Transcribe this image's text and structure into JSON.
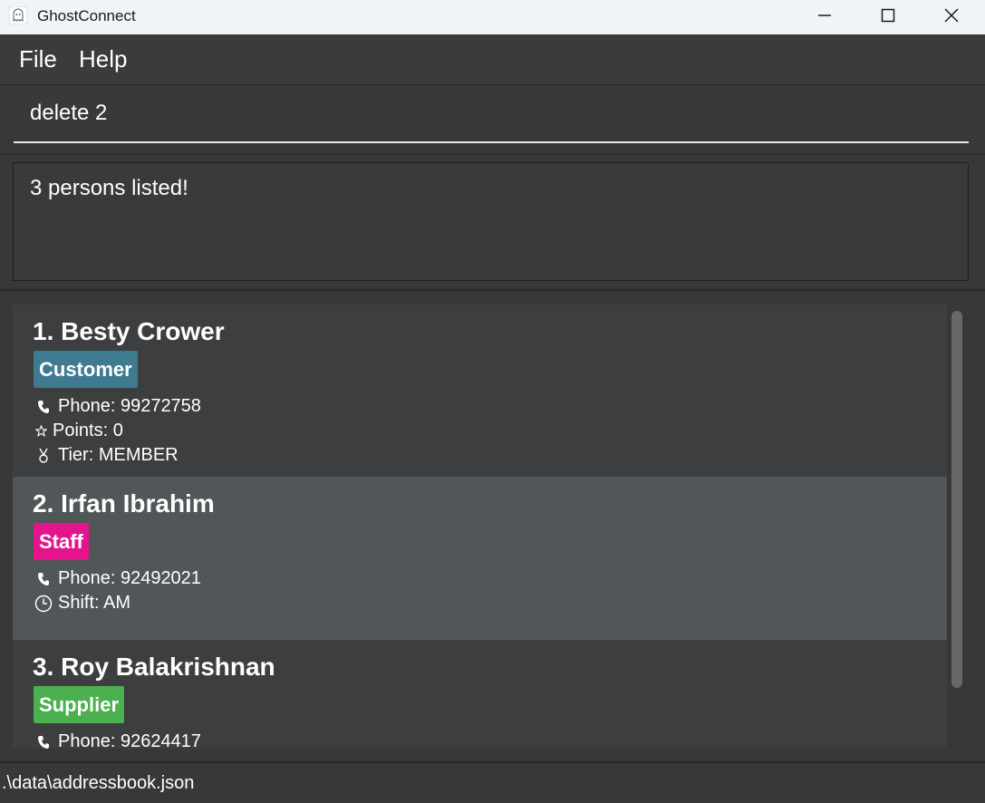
{
  "window": {
    "title": "GhostConnect",
    "app_icon": "ghost-icon",
    "controls": [
      "minimize-icon",
      "maximize-icon",
      "close-icon"
    ]
  },
  "menu": {
    "file_label": "File",
    "help_label": "Help"
  },
  "command": {
    "value": "delete 2"
  },
  "result": {
    "text": "3 persons listed!"
  },
  "persons": [
    {
      "name": "1. Besty Crower",
      "tag": "Customer",
      "tag_color": "#3e7b91",
      "fields": [
        {
          "icon": "phone-icon",
          "text": "Phone: 99272758"
        },
        {
          "icon": "star-icon",
          "text": "Points: 0"
        },
        {
          "icon": "medal-icon",
          "text": "Tier: MEMBER"
        }
      ]
    },
    {
      "name": "2. Irfan Ibrahim",
      "tag": "Staff",
      "tag_color": "#e3148c",
      "selected": true,
      "fields": [
        {
          "icon": "phone-icon",
          "text": "Phone: 92492021"
        },
        {
          "icon": "clock-icon",
          "text": "Shift: AM"
        }
      ]
    },
    {
      "name": "3. Roy Balakrishnan",
      "tag": "Supplier",
      "tag_color": "#4caf50",
      "fields": [
        {
          "icon": "phone-icon",
          "text": "Phone: 92624417"
        }
      ]
    }
  ],
  "status": {
    "file_path": ".\\data\\addressbook.json"
  }
}
